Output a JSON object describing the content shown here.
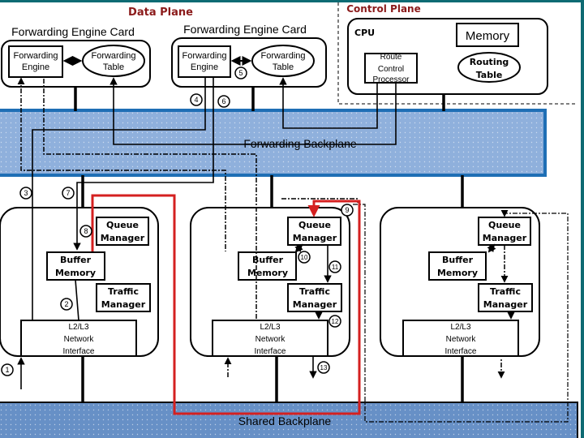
{
  "titles": {
    "data_plane": "Data Plane",
    "control_plane": "Control Plane"
  },
  "colors": {
    "frame": "#0e6b73",
    "plane_title": "#8b1a1a",
    "backplane_fill": "#8fb0dc",
    "shared_backplane_fill": "#6790c6",
    "backplane_border": "#1f6fb5",
    "highlight_path": "#d42020"
  },
  "forwarding_cards": [
    {
      "title": "Forwarding Engine Card",
      "engine": [
        "Forwarding",
        "Engine"
      ],
      "table": [
        "Forwarding",
        "Table"
      ]
    },
    {
      "title": "Forwarding Engine Card",
      "engine": [
        "Forwarding",
        "Engine"
      ],
      "table": [
        "Forwarding",
        "Table"
      ]
    }
  ],
  "cpu": {
    "label": "CPU",
    "memory": "Memory",
    "routing_table": [
      "Routing",
      "Table"
    ],
    "route_processor": [
      "Route",
      "Control",
      "Processor"
    ]
  },
  "forwarding_backplane": "Forwarding Backplane",
  "shared_backplane": "Shared Backplane",
  "line_cards": [
    {
      "queue": [
        "Queue",
        "Manager"
      ],
      "buffer": [
        "Buffer",
        "Memory"
      ],
      "traffic": [
        "Traffic",
        "Manager"
      ],
      "iface": [
        "L2/L3",
        "Network",
        "Interface"
      ]
    },
    {
      "queue": [
        "Queue",
        "Manager"
      ],
      "buffer": [
        "Buffer",
        "Memory"
      ],
      "traffic": [
        "Traffic",
        "Manager"
      ],
      "iface": [
        "L2/L3",
        "Network",
        "Interface"
      ]
    },
    {
      "queue": [
        "Queue",
        "Manager"
      ],
      "buffer": [
        "Buffer",
        "Memory"
      ],
      "traffic": [
        "Traffic",
        "Manager"
      ],
      "iface": [
        "L2/L3",
        "Network",
        "Interface"
      ]
    }
  ],
  "steps": [
    "1",
    "2",
    "3",
    "4",
    "5",
    "6",
    "7",
    "8",
    "9",
    "10",
    "11",
    "12",
    "13"
  ]
}
